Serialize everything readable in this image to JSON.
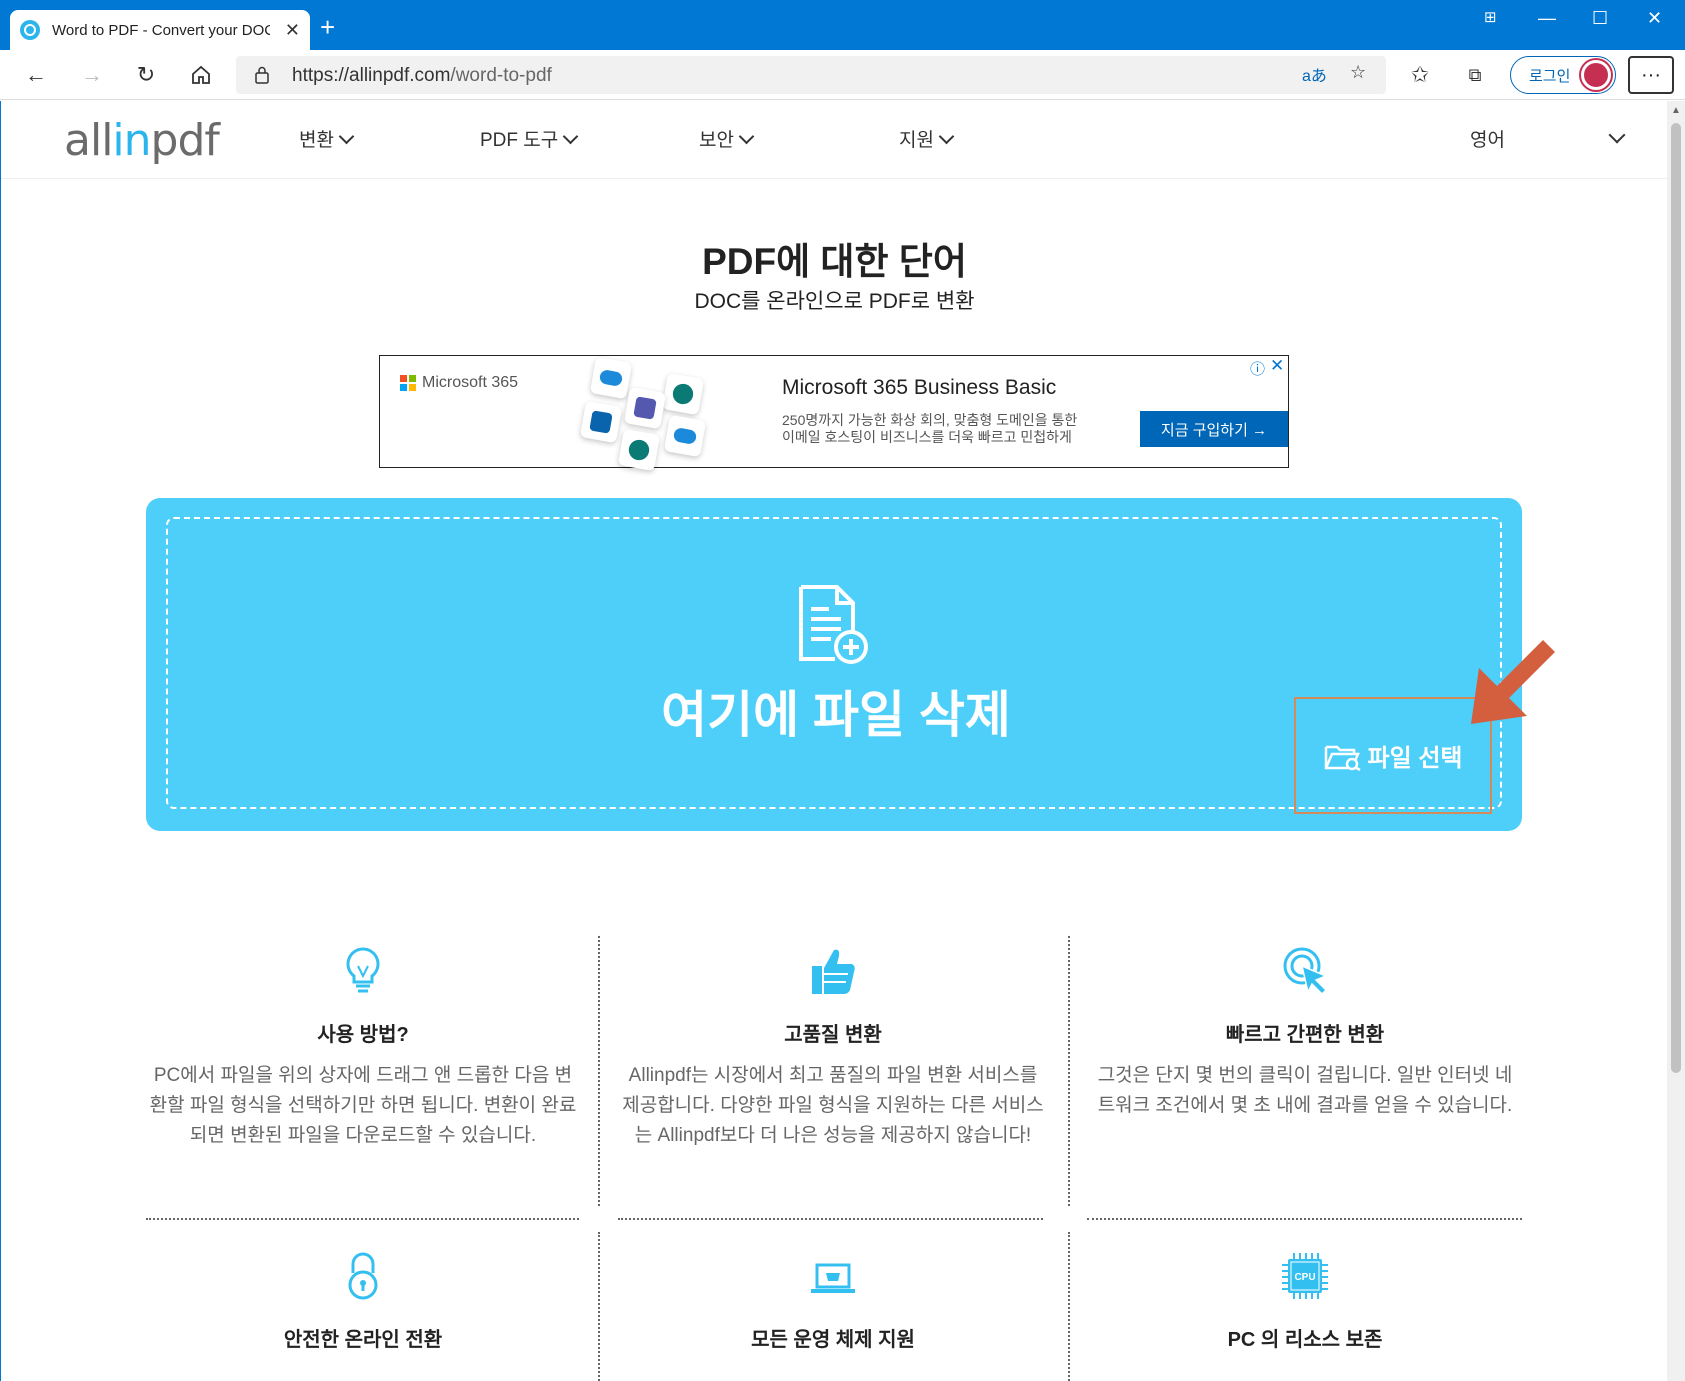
{
  "browser": {
    "tab_title": "Word to PDF - Convert your DOC",
    "url_host": "https://allinpdf.com",
    "url_path": "/word-to-pdf",
    "login_label": "로그인",
    "read_aloud": "aあ"
  },
  "site": {
    "logo_pre": "all",
    "logo_in": "in",
    "logo_post": "pdf",
    "nav": [
      {
        "label": "변환"
      },
      {
        "label": "PDF 도구"
      },
      {
        "label": "보안"
      },
      {
        "label": "지원"
      }
    ],
    "language": "영어"
  },
  "hero": {
    "title": "PDF에 대한 단어",
    "subtitle": "DOC를 온라인으로 PDF로 변환"
  },
  "ad": {
    "brand": "Microsoft 365",
    "title": "Microsoft 365 Business Basic",
    "desc_line1": "250명까지 가능한 화상 회의, 맞춤형 도메인을 통한",
    "desc_line2": "이메일 호스팅이 비즈니스를 더욱 빠르고 민첩하게",
    "cta": "지금 구입하기 →",
    "colors": {
      "red": "#f25022",
      "green": "#7fba00",
      "blue": "#00a4ef",
      "yellow": "#ffb900"
    }
  },
  "dropzone": {
    "text": "여기에 파일 삭제",
    "button": "파일 선택",
    "bg_color": "#4dcffa",
    "highlight_color": "#d35f3f"
  },
  "features": [
    {
      "icon": "lightbulb-icon",
      "title": "사용 방법?",
      "desc": "PC에서 파일을 위의 상자에 드래그 앤 드롭한 다음 변환할 파일 형식을 선택하기만 하면 됩니다. 변환이 완료되면 변환된 파일을 다운로드할 수 있습니다."
    },
    {
      "icon": "thumbs-up-icon",
      "title": "고품질 변환",
      "desc": "Allinpdf는 시장에서 최고 품질의 파일 변환 서비스를 제공합니다. 다양한 파일 형식을 지원하는 다른 서비스는 Allinpdf보다 더 나은 성능을 제공하지 않습니다!"
    },
    {
      "icon": "click-icon",
      "title": "빠르고 간편한 변환",
      "desc": "그것은 단지 몇 번의 클릭이 걸립니다. 일반 인터넷 네트워크 조건에서 몇 초 내에 결과를 얻을 수 있습니다."
    },
    {
      "icon": "padlock-icon",
      "title": "안전한 온라인 전환"
    },
    {
      "icon": "laptop-icon",
      "title": "모든 운영 체제 지원"
    },
    {
      "icon": "cpu-icon",
      "title": "PC 의 리소스 보존",
      "icon_text": "CPU"
    }
  ]
}
